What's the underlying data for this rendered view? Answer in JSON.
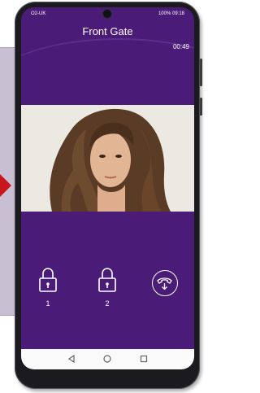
{
  "status_bar": {
    "left_text": "O2-UK",
    "right_text": "100% 09:18"
  },
  "call": {
    "title": "Front Gate",
    "timer": "00:49"
  },
  "controls": {
    "lock1_label": "1",
    "lock2_label": "2"
  },
  "icons": {
    "lock": "padlock-icon",
    "hangup": "phone-hangup-icon",
    "back": "nav-back-triangle",
    "home": "nav-home-circle",
    "recents": "nav-recents-square"
  },
  "colors": {
    "screen_bg": "#4b1b78",
    "accent_arrow": "#c8161c",
    "navbar_bg": "#fafafa"
  }
}
